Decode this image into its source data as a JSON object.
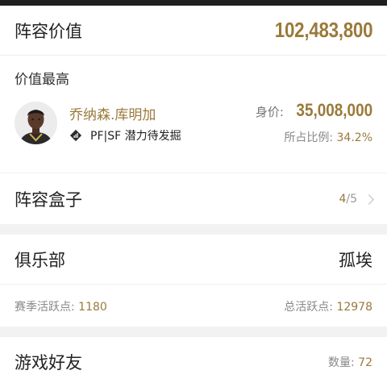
{
  "lineup_value": {
    "label": "阵容价值",
    "amount": "102,483,800"
  },
  "top_value": {
    "label": "价值最高",
    "player": {
      "name": "乔纳森.库明加",
      "position_tags": "PF|SF 潜力待发掘",
      "badge_icon": "diamond-badge-icon",
      "price_label": "身价: ",
      "price_value": "35,008,000",
      "ratio_label": "所占比例: ",
      "ratio_value": "34.2%"
    }
  },
  "lineup_box": {
    "label": "阵容盒子",
    "current": "4",
    "total": "/5",
    "chevron_icon": "chevron-right-icon"
  },
  "club": {
    "label": "俱乐部",
    "name": "孤埃",
    "season_activity_label": "赛季活跃点: ",
    "season_activity_value": "1180",
    "total_activity_label": "总活跃点: ",
    "total_activity_value": "12978"
  },
  "friends": {
    "label": "游戏好友",
    "count_label": "数量: ",
    "count_value": "72"
  },
  "colors": {
    "accent_gold": "#9a7a3a",
    "divider": "#f2f2f2",
    "top_bar": "#1f1f1f"
  }
}
